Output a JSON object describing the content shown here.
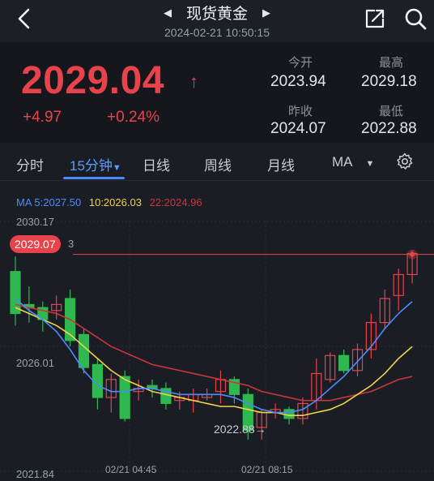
{
  "header": {
    "title": "现货黄金",
    "datetime": "2024-02-21 10:50:15"
  },
  "quote": {
    "price": "2029.04",
    "change": "+4.97",
    "change_pct": "+0.24%",
    "open_label": "今开",
    "open": "2023.94",
    "high_label": "最高",
    "high": "2029.18",
    "prev_close_label": "昨收",
    "prev_close": "2024.07",
    "low_label": "最低",
    "low": "2022.88"
  },
  "tabs": {
    "items": [
      "分时",
      "15分钟",
      "日线",
      "周线",
      "月线",
      "MA"
    ],
    "active": "15分钟"
  },
  "colors": {
    "up": "#e8434b",
    "down": "#2fb84f",
    "ma5": "#4a8cff",
    "ma10": "#f2d34a",
    "ma22": "#c9363e",
    "accent": "#4a8cff"
  },
  "chart_data": {
    "type": "candlestick",
    "ma_legend": {
      "ma5": "MA 5:2027.50",
      "ma10": "10:2026.03",
      "ma22": "22:2024.96"
    },
    "y_ticks": [
      "2030.17",
      "2026.01",
      "2021.84"
    ],
    "ylim": [
      2021.84,
      2030.17
    ],
    "x_ticks": [
      "02/21 04:45",
      "02/21 08:15"
    ],
    "current_price_tag": "2029.07",
    "current_price_tag_tail": "3",
    "current_price": 2029.07,
    "low_marker": "2022.88→",
    "candles": [
      {
        "o": 2028.5,
        "h": 2029.0,
        "c": 2027.1,
        "l": 2026.7
      },
      {
        "o": 2027.4,
        "h": 2028.0,
        "c": 2027.3,
        "l": 2026.8
      },
      {
        "o": 2027.3,
        "h": 2027.5,
        "c": 2026.9,
        "l": 2026.5
      },
      {
        "o": 2027.2,
        "h": 2027.7,
        "c": 2027.4,
        "l": 2026.9
      },
      {
        "o": 2027.6,
        "h": 2027.9,
        "c": 2026.2,
        "l": 2026.0
      },
      {
        "o": 2026.4,
        "h": 2026.6,
        "c": 2025.3,
        "l": 2025.1
      },
      {
        "o": 2025.4,
        "h": 2025.6,
        "c": 2024.3,
        "l": 2023.9
      },
      {
        "o": 2024.3,
        "h": 2025.1,
        "c": 2024.9,
        "l": 2023.8
      },
      {
        "o": 2025.0,
        "h": 2025.2,
        "c": 2023.6,
        "l": 2023.5
      },
      {
        "o": 2024.5,
        "h": 2024.9,
        "c": 2024.6,
        "l": 2024.2
      },
      {
        "o": 2024.7,
        "h": 2024.9,
        "c": 2024.6,
        "l": 2024.3
      },
      {
        "o": 2024.6,
        "h": 2024.8,
        "c": 2024.1,
        "l": 2023.9
      },
      {
        "o": 2024.2,
        "h": 2024.5,
        "c": 2024.3,
        "l": 2023.9
      },
      {
        "o": 2024.2,
        "h": 2024.6,
        "c": 2024.4,
        "l": 2023.8
      },
      {
        "o": 2024.3,
        "h": 2024.6,
        "c": 2024.4,
        "l": 2024.2
      },
      {
        "o": 2024.5,
        "h": 2025.2,
        "c": 2024.9,
        "l": 2024.1
      },
      {
        "o": 2024.9,
        "h": 2025.0,
        "c": 2024.4,
        "l": 2024.1
      },
      {
        "o": 2024.4,
        "h": 2024.6,
        "c": 2023.2,
        "l": 2022.9
      },
      {
        "o": 2023.3,
        "h": 2023.9,
        "c": 2023.8,
        "l": 2022.9
      },
      {
        "o": 2023.8,
        "h": 2024.1,
        "c": 2023.9,
        "l": 2023.6
      },
      {
        "o": 2023.9,
        "h": 2024.0,
        "c": 2023.6,
        "l": 2023.4
      },
      {
        "o": 2023.6,
        "h": 2024.3,
        "c": 2024.1,
        "l": 2023.4
      },
      {
        "o": 2024.2,
        "h": 2025.6,
        "c": 2025.1,
        "l": 2023.9
      },
      {
        "o": 2024.9,
        "h": 2025.8,
        "c": 2025.7,
        "l": 2024.8
      },
      {
        "o": 2025.7,
        "h": 2025.9,
        "c": 2025.2,
        "l": 2025.1
      },
      {
        "o": 2025.2,
        "h": 2026.1,
        "c": 2025.9,
        "l": 2025.0
      },
      {
        "o": 2025.9,
        "h": 2027.1,
        "c": 2026.8,
        "l": 2025.6
      },
      {
        "o": 2026.8,
        "h": 2027.9,
        "c": 2027.6,
        "l": 2026.6
      },
      {
        "o": 2027.7,
        "h": 2028.6,
        "c": 2028.4,
        "l": 2027.2
      },
      {
        "o": 2028.4,
        "h": 2029.2,
        "c": 2029.1,
        "l": 2028.1
      }
    ],
    "ma5": [
      2027.6,
      2027.2,
      2026.9,
      2026.5,
      2025.9,
      2025.2,
      2024.7,
      2024.5,
      2024.5,
      2024.6,
      2024.6,
      2024.5,
      2024.4,
      2024.4,
      2024.4,
      2024.4,
      2024.3,
      2024.1,
      2023.9,
      2023.8,
      2023.8,
      2023.9,
      2024.2,
      2024.6,
      2025.0,
      2025.5,
      2026.0,
      2026.6,
      2027.1,
      2027.5
    ],
    "ma10": [
      2027.3,
      2027.1,
      2026.9,
      2026.7,
      2026.4,
      2026.0,
      2025.6,
      2025.2,
      2024.9,
      2024.7,
      2024.5,
      2024.4,
      2024.3,
      2024.2,
      2024.1,
      2024.0,
      2024.0,
      2023.9,
      2023.8,
      2023.8,
      2023.7,
      2023.7,
      2023.8,
      2023.9,
      2024.1,
      2024.4,
      2024.7,
      2025.1,
      2025.6,
      2026.0
    ],
    "ma22": [
      2027.4,
      2027.3,
      2027.2,
      2027.1,
      2026.9,
      2026.6,
      2026.3,
      2026.0,
      2025.8,
      2025.6,
      2025.4,
      2025.3,
      2025.2,
      2025.1,
      2025.0,
      2024.9,
      2024.8,
      2024.7,
      2024.5,
      2024.4,
      2024.3,
      2024.2,
      2024.2,
      2024.2,
      2024.3,
      2024.4,
      2024.5,
      2024.7,
      2024.9,
      2025.0
    ]
  }
}
